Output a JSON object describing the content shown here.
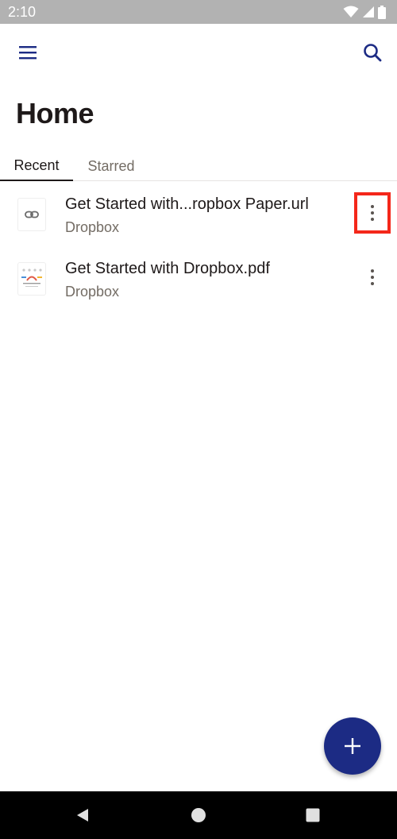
{
  "status_bar": {
    "time": "2:10",
    "icons": [
      "wifi-icon",
      "signal-icon",
      "battery-icon"
    ]
  },
  "app_bar": {
    "icons": [
      "hamburger-menu-icon",
      "search-icon"
    ],
    "accent_color": "#1c2b84"
  },
  "page": {
    "title": "Home"
  },
  "tabs": [
    {
      "label": "Recent",
      "selected": true
    },
    {
      "label": "Starred",
      "selected": false
    }
  ],
  "files": [
    {
      "name": "Get Started with...ropbox Paper.url",
      "subtitle": "Dropbox",
      "thumbnail_icon": "link-icon",
      "menu_highlighted": true
    },
    {
      "name": "Get Started with Dropbox.pdf",
      "subtitle": "Dropbox",
      "thumbnail_icon": "pdf-thumbnail",
      "menu_highlighted": false
    }
  ],
  "fab": {
    "icon": "plus-icon",
    "color": "#1c2b84"
  },
  "nav_bar": {
    "icons": [
      "back-icon",
      "home-icon",
      "recents-icon"
    ]
  },
  "highlight_color": "#f4271a"
}
